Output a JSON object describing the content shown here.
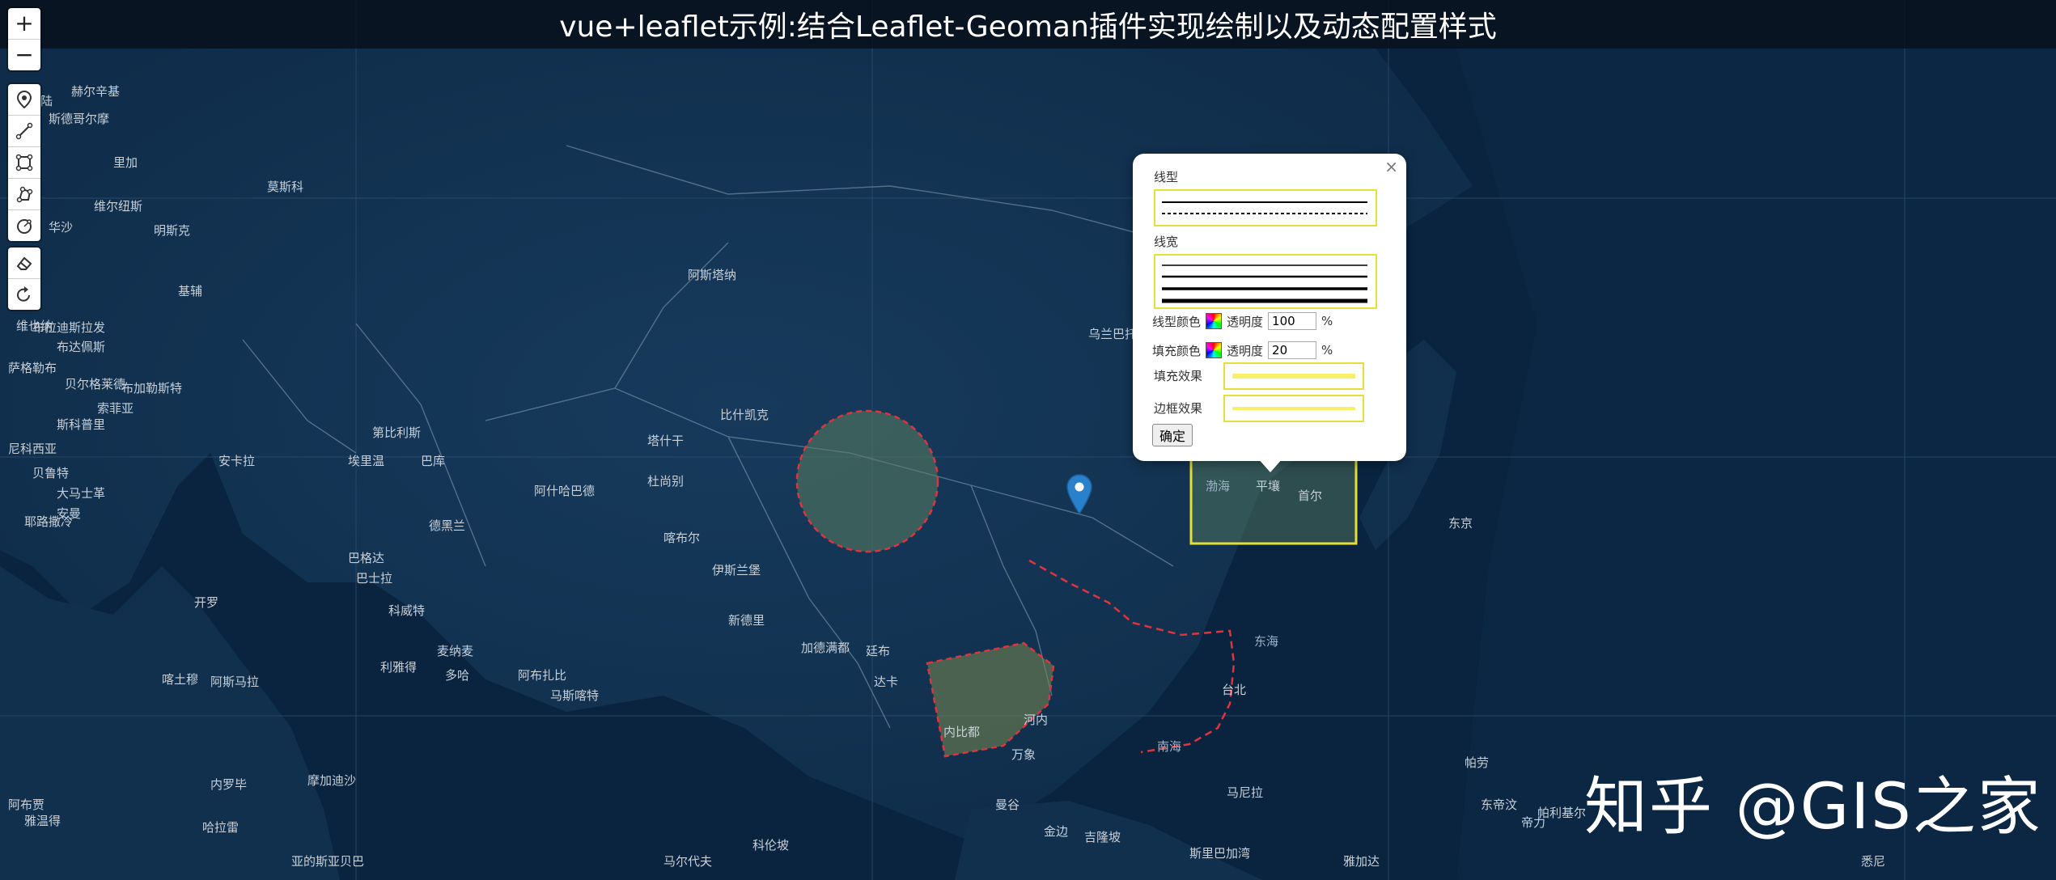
{
  "title": "vue+leaflet示例:结合Leaflet-Geoman插件实现绘制以及动态配置样式",
  "zoom_controls": {
    "zoom_in": "+",
    "zoom_out": "−"
  },
  "geoman_toolbar": {
    "draw_tools": [
      "marker-icon",
      "polyline-icon",
      "rectangle-icon",
      "polygon-icon",
      "circle-icon"
    ],
    "edit_tools": [
      "eraser-icon",
      "rotate-icon"
    ]
  },
  "popup": {
    "close": "×",
    "line_type_label": "线型",
    "line_width_label": "线宽",
    "line_color_label": "线型颜色",
    "fill_color_label": "填充颜色",
    "opacity_label": "透明度",
    "line_opacity": "100",
    "fill_opacity": "20",
    "percent": "%",
    "fill_effect_label": "填充效果",
    "border_effect_label": "边框效果",
    "confirm": "确定"
  },
  "watermark": "知乎 @GIS之家",
  "colors": {
    "map_bg": "#0a2440",
    "land": "#11304e",
    "drawn_fill": "#5a8060",
    "dashed_stroke": "#e0343c",
    "highlight_border": "#e6df3b",
    "marker": "#2a81cb"
  },
  "map_labels": [
    "赫尔辛基",
    "斯德哥尔摩",
    "奥斯陆",
    "里加",
    "维尔纽斯",
    "明斯克",
    "莫斯科",
    "华沙",
    "基辅",
    "维也纳",
    "布拉迪斯拉发",
    "布达佩斯",
    "萨格勒布",
    "贝尔格莱德",
    "布加勒斯特",
    "索菲亚",
    "斯科普里",
    "第比利斯",
    "埃里温",
    "巴库",
    "安卡拉",
    "尼科西亚",
    "贝鲁特",
    "大马士革",
    "安曼",
    "耶路撒冷",
    "巴格达",
    "科威特",
    "利雅得",
    "麦纳麦",
    "多哈",
    "阿布扎比",
    "马斯喀特",
    "德黑兰",
    "阿什哈巴德",
    "塔什干",
    "杜尚别",
    "比什凯克",
    "喀布尔",
    "伊斯兰堡",
    "新德里",
    "加德满都",
    "廷布",
    "达卡",
    "内比都",
    "河内",
    "万象",
    "曼谷",
    "金边",
    "科伦坡",
    "马尔代夫",
    "阿斯塔纳",
    "乌兰巴托",
    "渤海",
    "平壤",
    "首尔",
    "东京",
    "台北",
    "东海",
    "南海",
    "马尼拉",
    "帝力",
    "雅加达",
    "吉隆坡",
    "斯里巴加湾",
    "东帝汶",
    "哈拉雷",
    "开罗",
    "巴士拉",
    "亚的斯亚贝巴",
    "内罗毕",
    "摩加迪沙",
    "阿斯马拉",
    "喀土穆",
    "雅温得",
    "阿布贾",
    "帕劳",
    "帕利基尔",
    "悉尼"
  ]
}
